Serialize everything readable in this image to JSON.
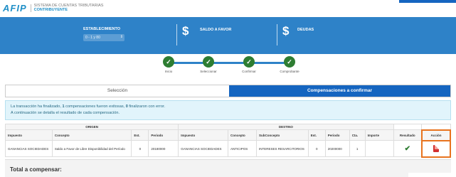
{
  "header": {
    "logo_mark": "AFIP",
    "system_title": "SISTEMA DE CUENTAS TRIBUTARIAS",
    "system_subtitle": "CONTRIBUYENTE"
  },
  "summary": {
    "establecimiento_label": "ESTABLECIMIENTO",
    "establecimiento_value": "0 - 1 y 80",
    "saldo_label": "SALDO A FAVOR",
    "deudas_label": "DEUDAS",
    "currency_symbol": "$"
  },
  "steps": [
    {
      "label": "Inicio",
      "icon": "check-icon"
    },
    {
      "label": "Seleccionar",
      "icon": "check-icon"
    },
    {
      "label": "Confirmar",
      "icon": "check-icon"
    },
    {
      "label": "Comprobante",
      "icon": "check-icon"
    }
  ],
  "tabs": {
    "seleccion": "Selección",
    "compensaciones": "Compensaciones a confirmar"
  },
  "info": {
    "line1_prefix": "La transacción ha finalizado, ",
    "ok_count": "1",
    "line1_mid": " compensaciones fueron exitosas, ",
    "err_count": "0",
    "line1_suffix": " finalizaron con error.",
    "line2": "A continuación se detalla el resultado de cada compensación."
  },
  "table": {
    "group_origen": "ORIGEN",
    "group_destino": "DESTINO",
    "headers": {
      "impuesto": "Impuesto",
      "concepto": "Concepto",
      "est": "Est.",
      "periodo": "Periodo",
      "impuesto2": "Impuesto",
      "concepto2": "Concepto",
      "subconcepto": "SubConcepto",
      "est2": "Est.",
      "periodo2": "Periodo",
      "cta": "Cta.",
      "importe": "Importe",
      "resultado": "Resultado",
      "accion": "Acción"
    },
    "rows": [
      {
        "impuesto": "GANANCIAS SOCIEDADES",
        "concepto": "Saldo a Favor de Libre Disponibilidad del Período",
        "est": "0",
        "periodo": "20180000",
        "impuesto2": "GANANCIAS SOCIEDADES",
        "concepto2": "ANTICIPOS",
        "subconcepto": "INTERESES RESARCITORIOS",
        "est2": "0",
        "periodo2": "20200000",
        "cta": "1",
        "importe": "",
        "resultado_icon": "check-icon",
        "accion_icon": "pdf-icon"
      }
    ]
  },
  "total": {
    "label": "Total a compensar:"
  },
  "colors": {
    "band": "#2e82c8",
    "tab_active": "#1565c0",
    "success": "#2e7d32",
    "highlight": "#e8731e",
    "pdf": "#d32f2f"
  }
}
